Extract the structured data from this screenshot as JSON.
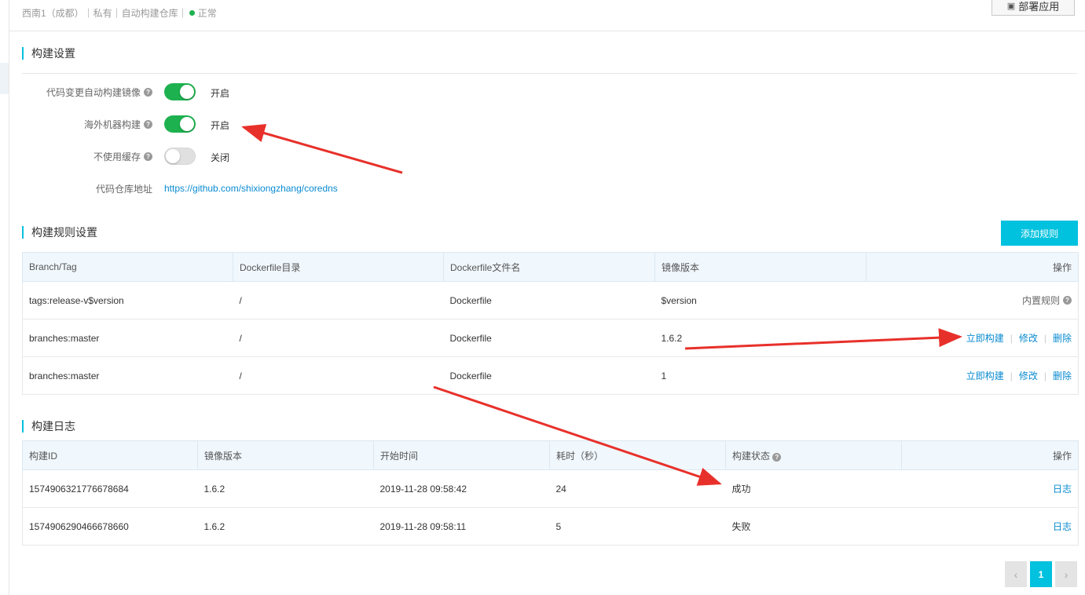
{
  "header": {
    "meta": "西南1（成都）｜私有｜自动构建仓库｜",
    "status_text": "正常",
    "deploy_button": "部署应用"
  },
  "build_settings": {
    "title": "构建设置",
    "rows": [
      {
        "label": "代码变更自动构建镜像",
        "state": "开启",
        "on": true
      },
      {
        "label": "海外机器构建",
        "state": "开启",
        "on": true
      },
      {
        "label": "不使用缓存",
        "state": "关闭",
        "on": false
      }
    ],
    "repo_label": "代码仓库地址",
    "repo_url": "https://github.com/shixiongzhang/coredns"
  },
  "build_rules": {
    "title": "构建规则设置",
    "add_button": "添加规则",
    "columns": [
      "Branch/Tag",
      "Dockerfile目录",
      "Dockerfile文件名",
      "镜像版本",
      "操作"
    ],
    "rows": [
      {
        "branch": "tags:release-v$version",
        "dir": "/",
        "file": "Dockerfile",
        "version": "$version",
        "builtin": "内置规则"
      },
      {
        "branch": "branches:master",
        "dir": "/",
        "file": "Dockerfile",
        "version": "1.6.2",
        "actions": [
          "立即构建",
          "修改",
          "删除"
        ]
      },
      {
        "branch": "branches:master",
        "dir": "/",
        "file": "Dockerfile",
        "version": "1",
        "actions": [
          "立即构建",
          "修改",
          "删除"
        ]
      }
    ]
  },
  "build_log": {
    "title": "构建日志",
    "columns": [
      "构建ID",
      "镜像版本",
      "开始时间",
      "耗时（秒）",
      "构建状态",
      "操作"
    ],
    "rows": [
      {
        "id": "1574906321776678684",
        "version": "1.6.2",
        "start": "2019-11-28 09:58:42",
        "duration": "24",
        "status": "成功",
        "action": "日志"
      },
      {
        "id": "1574906290466678660",
        "version": "1.6.2",
        "start": "2019-11-28 09:58:11",
        "duration": "5",
        "status": "失败",
        "action": "日志"
      }
    ]
  },
  "pagination": {
    "prev": "‹",
    "current": "1",
    "next": "›"
  },
  "colors": {
    "accent": "#00c1de",
    "link": "#0a8bd1",
    "success": "#1eb14f",
    "fail": "#e8453c",
    "annotation": "#e8302a"
  },
  "icons": {
    "help": "question-circle-icon",
    "deploy": "cube-icon"
  }
}
